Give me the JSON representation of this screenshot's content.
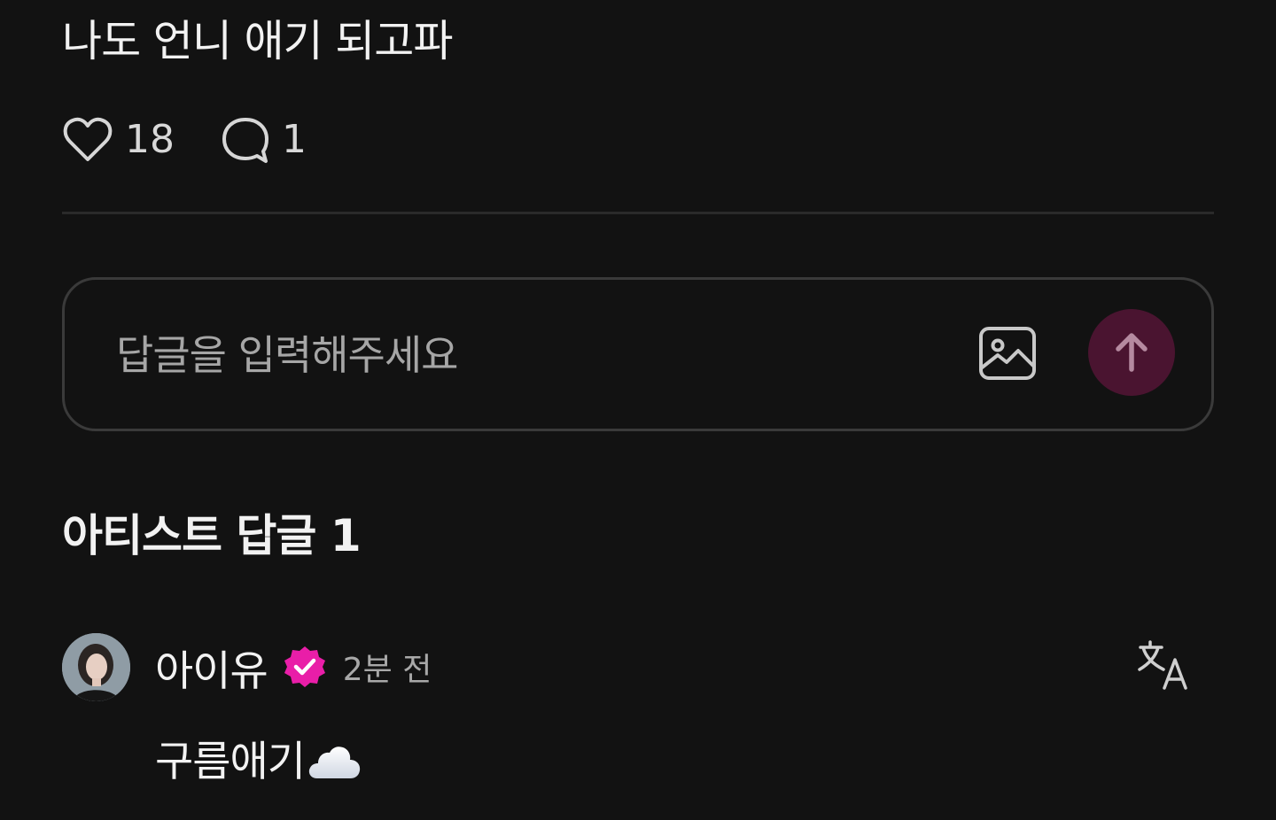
{
  "post": {
    "text": "나도 언니 애기 되고파",
    "likes": "18",
    "comments": "1"
  },
  "reply": {
    "placeholder": "답글을 입력해주세요",
    "image_icon": "image-icon",
    "send_icon": "arrow-up-icon"
  },
  "artist_replies": {
    "title": "아티스트 답글 1",
    "items": [
      {
        "author": "아이유",
        "verified_icon": "verified-badge-icon",
        "time": "2분 전",
        "text": "구름애기",
        "emoji": "cloud-icon"
      }
    ]
  },
  "colors": {
    "background": "#121212",
    "accent": "#4a1430",
    "verified": "#e91ea8",
    "muted": "#a8a8a8"
  }
}
